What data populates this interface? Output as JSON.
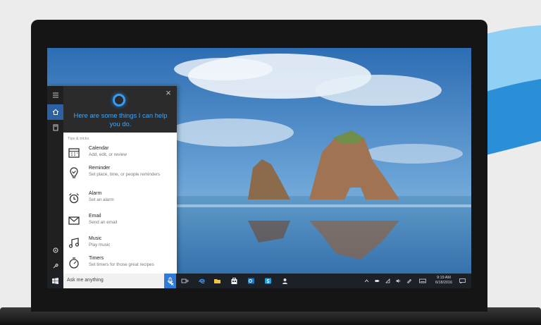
{
  "cortana": {
    "greeting": "Here are some things I can help you do.",
    "section_label": "Tips & tricks",
    "items": [
      {
        "title": "Calendar",
        "subtitle": "Add, edit, or review",
        "icon": "calendar-icon"
      },
      {
        "title": "Reminder",
        "subtitle": "Set place, time, or people reminders",
        "icon": "reminder-icon"
      },
      {
        "title": "Alarm",
        "subtitle": "Set an alarm",
        "icon": "alarm-icon"
      },
      {
        "title": "Email",
        "subtitle": "Send an email",
        "icon": "email-icon"
      },
      {
        "title": "Music",
        "subtitle": "Play music",
        "icon": "music-icon"
      },
      {
        "title": "Timers",
        "subtitle": "Set timers for those great recipes",
        "icon": "timer-icon"
      }
    ],
    "rail_icons": [
      "hamburger-icon",
      "home-icon",
      "notebook-icon",
      "settings-icon",
      "feedback-icon"
    ]
  },
  "taskbar": {
    "search_placeholder": "Ask me anything",
    "apps": [
      "task-view-icon",
      "edge-icon",
      "file-explorer-icon",
      "store-icon",
      "outlook-icon",
      "skype-icon",
      "people-icon",
      "photos-icon"
    ],
    "tray_icons": [
      "chevron-up-icon",
      "battery-icon",
      "network-icon",
      "volume-icon",
      "pen-icon",
      "keyboard-icon"
    ],
    "time": "9:19 AM",
    "date": "6/18/2016"
  },
  "colors": {
    "accent": "#2f7bd7",
    "cortana_text": "#46a4f2",
    "taskbar": "#1c2127"
  }
}
